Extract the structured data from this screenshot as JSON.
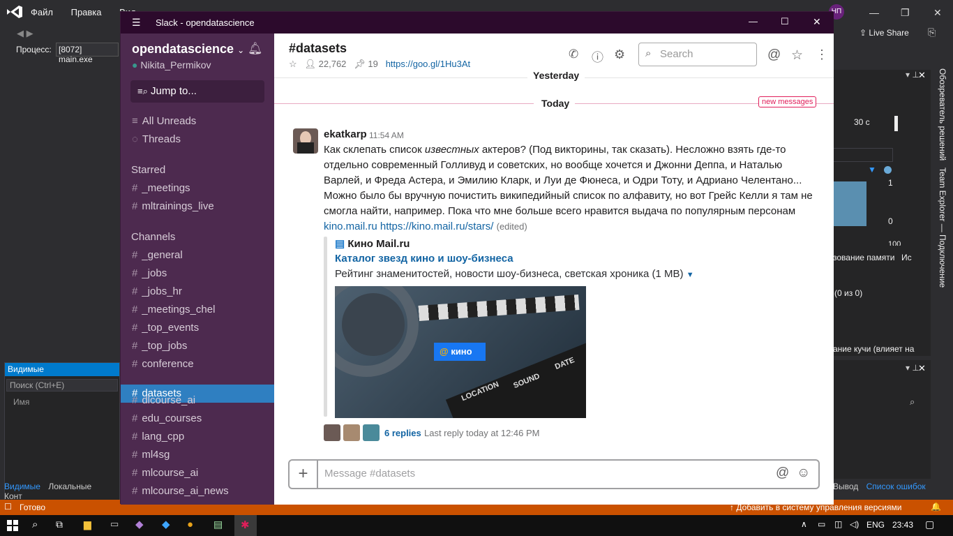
{
  "vs": {
    "menu": [
      "Файл",
      "Правка",
      "Вид"
    ],
    "process_label": "Процесс:",
    "process_value": "[8072] main.exe",
    "user_initials": "НП",
    "live_share": "Live Share",
    "left_panel": {
      "header": "Видимые",
      "search": "Поиск (Ctrl+E)",
      "column": "Имя"
    },
    "left_tabs": [
      "Видимые",
      "Локальные",
      "Конт"
    ],
    "right_vertical_1": "Обозреватель решений",
    "right_vertical_2": "Team Explorer — Подключение",
    "diag": {
      "tick_30s": "30 с",
      "val_1": "1",
      "val_0": "0",
      "val_100": "100",
      "memory_label": "зование памяти",
      "is_label": "Ис",
      "count_label": "(0 из 0)",
      "heap_label": "ание кучи (влияет на"
    },
    "bottom_right_tabs": [
      "Вывод",
      "Список ошибок"
    ],
    "status_left": "Готово",
    "status_right": "Добавить в систему управления версиями",
    "tray_lang": "ENG",
    "tray_time": "23:43"
  },
  "slack": {
    "window_title": "Slack - opendatascience",
    "workspace": "opendatascience",
    "user": "Nikita_Permikov",
    "jump_to": "Jump to...",
    "nav": {
      "all_unreads": "All Unreads",
      "threads": "Threads"
    },
    "starred_label": "Starred",
    "starred": [
      "_meetings",
      "mltrainings_live"
    ],
    "channels_label": "Channels",
    "channels": [
      "_general",
      "_jobs",
      "_jobs_hr",
      "_meetings_chel",
      "_top_events",
      "_top_jobs",
      "conference",
      "datasets",
      "dlcourse_ai",
      "edu_courses",
      "lang_cpp",
      "ml4sg",
      "mlcourse_ai",
      "mlcourse_ai_news"
    ],
    "active_channel": "datasets",
    "channel_header": {
      "name": "#datasets",
      "members": "22,762",
      "pins": "19",
      "link": "https://goo.gl/1Hu3At",
      "search_placeholder": "Search"
    },
    "yesterday": "Yesterday",
    "today": "Today",
    "new_messages": "new messages",
    "message": {
      "author": "ekatkarp",
      "time": "11:54 AM",
      "text_1": "Как склепать список ",
      "text_em": "известных",
      "text_2": " актеров? (Под викторины, так сказать). Несложно взять где-то отдельно современный Голливуд и советских, но вообще хочется и Джонни Деппа, и Наталью Варлей, и Фреда Астера, и Эмилию Кларк, и Луи де Фюнеса, и Одри Тоту, и Адриано Челентано... Можно было бы вручную почистить википедийный список по алфавиту, но вот Грейс Келли я там не смогла найти, например. Пока что мне больше всего нравится выдача по популярным персонам",
      "link_1": "kino.mail.ru",
      "link_2": "https://kino.mail.ru/stars/",
      "edited": "(edited)"
    },
    "attachment": {
      "site": "Кино Mail.ru",
      "title": "Каталог звезд кино и шоу-бизнеса",
      "description": "Рейтинг знаменитостей, новости шоу-бизнеса, светская хроника (1 MB)",
      "logo_text": "кино",
      "clap_1": "LOCATION",
      "clap_2": "SOUND",
      "clap_3": "DATE"
    },
    "replies": {
      "count": "6 replies",
      "last": "Last reply today at 12:46 PM"
    },
    "composer_placeholder": "Message #datasets"
  }
}
